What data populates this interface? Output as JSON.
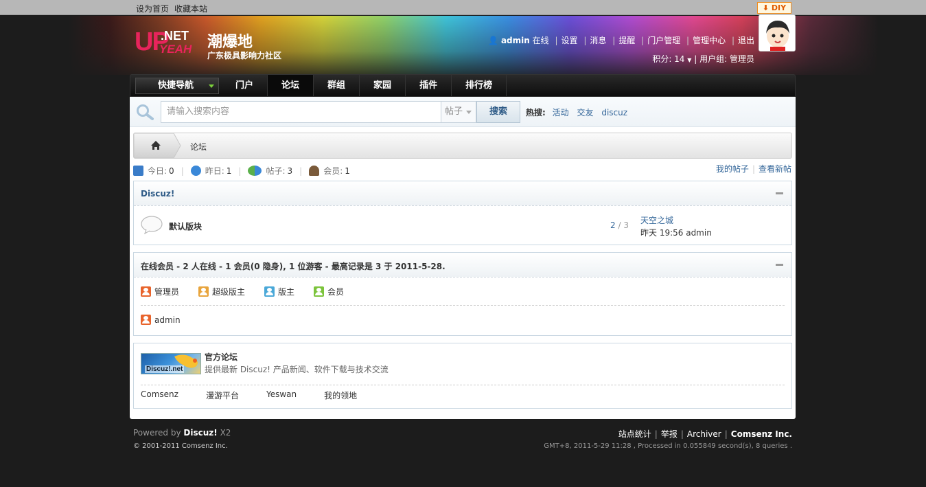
{
  "topbar": {
    "set_home": "设为首页",
    "bookmark": "收藏本站",
    "diy": "DIY"
  },
  "header": {
    "logo_up": "UP",
    "logo_net": ".NET",
    "logo_yeah": "YEAH",
    "site_name": "潮爆地",
    "slogan": "广东极具影响力社区"
  },
  "user": {
    "name": "admin",
    "status": "在线",
    "links": [
      "设置",
      "消息",
      "提醒",
      "门户管理",
      "管理中心",
      "退出"
    ],
    "points_label": "积分: 14",
    "group_label": "用户组: 管理员"
  },
  "nav": {
    "quick": "快捷导航",
    "items": [
      "门户",
      "论坛",
      "群组",
      "家园",
      "插件",
      "排行榜"
    ],
    "active_index": 1
  },
  "search": {
    "placeholder": "请输入搜索内容",
    "type": "帖子",
    "button": "搜索",
    "hot_label": "热搜:",
    "hot_terms": [
      "活动",
      "交友",
      "discuz"
    ]
  },
  "breadcrumb": {
    "current": "论坛"
  },
  "stats": {
    "today_label": "今日:",
    "today": "0",
    "yesterday_label": "昨日:",
    "yesterday": "1",
    "posts_label": "帖子:",
    "posts": "3",
    "members_label": "会员:",
    "members": "1",
    "my_posts": "我的帖子",
    "new_posts": "查看新帖"
  },
  "category": {
    "title": "Discuz!",
    "forum": {
      "name": "默认版块",
      "threads": "2",
      "slash": "/",
      "posts": "3",
      "last_title": "天空之城",
      "last_meta": "昨天 19:56 admin"
    }
  },
  "online": {
    "title": "在线会员 - 2 人在线 - 1 会员(0 隐身), 1 位游客 - 最高记录是 3 于 2011-5-28.",
    "legend": [
      {
        "label": "管理员",
        "color": "#e8642c"
      },
      {
        "label": "超级版主",
        "color": "#e8a43c"
      },
      {
        "label": "版主",
        "color": "#4aa8d8"
      },
      {
        "label": "会员",
        "color": "#7cc43c"
      }
    ],
    "users": [
      {
        "name": "admin",
        "color": "#e8642c"
      }
    ]
  },
  "links": {
    "official_logo_text": "Discuz!.net",
    "official_name": "官方论坛",
    "official_desc": "提供最新 Discuz! 产品新闻、软件下载与技术交流",
    "text_links": [
      "Comsenz",
      "漫游平台",
      "Yeswan",
      "我的领地"
    ]
  },
  "footer": {
    "powered_prefix": "Powered by",
    "powered_brand": "Discuz!",
    "version": "X2",
    "copyright": "© 2001-2011 Comsenz Inc.",
    "links": [
      "站点统计",
      "举报",
      "Archiver"
    ],
    "company": "Comsenz Inc.",
    "info": "GMT+8, 2011-5-29 11:28 , Processed in 0.055849 second(s), 8 queries ."
  }
}
